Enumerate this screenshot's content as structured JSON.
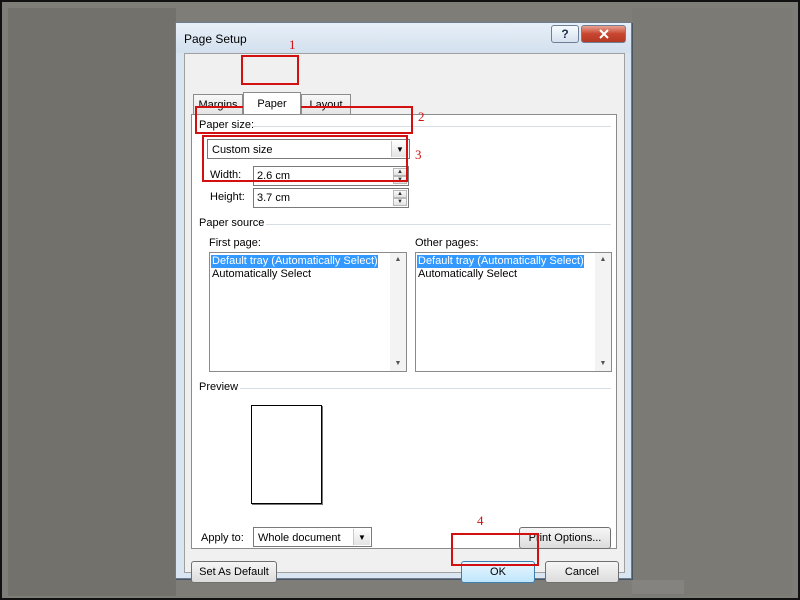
{
  "dialog": {
    "title": "Page Setup",
    "help_icon": "?",
    "close_icon": "x"
  },
  "tabs": [
    {
      "label": "Margins",
      "active": false
    },
    {
      "label": "Paper",
      "active": true
    },
    {
      "label": "Layout",
      "active": false
    }
  ],
  "paper_size": {
    "label": "Paper size:",
    "value": "Custom size",
    "width_label": "Width:",
    "width_value": "2.6 cm",
    "height_label": "Height:",
    "height_value": "3.7 cm"
  },
  "paper_source": {
    "label": "Paper source",
    "first_page": {
      "label": "First page:",
      "items": [
        "Default tray (Automatically Select)",
        "Automatically Select"
      ],
      "selected": "Default tray (Automatically Select)"
    },
    "other_pages": {
      "label": "Other pages:",
      "items": [
        "Default tray (Automatically Select)",
        "Automatically Select"
      ],
      "selected": "Default tray (Automatically Select)"
    }
  },
  "preview": {
    "label": "Preview"
  },
  "apply_to": {
    "label": "Apply to:",
    "value": "Whole document"
  },
  "buttons": {
    "print_options": "Print Options...",
    "set_as_default": "Set As Default",
    "ok": "OK",
    "cancel": "Cancel"
  },
  "annotations": [
    "1",
    "2",
    "3",
    "4"
  ],
  "colors": {
    "annotation": "#d21010",
    "selection": "#3399ff"
  }
}
